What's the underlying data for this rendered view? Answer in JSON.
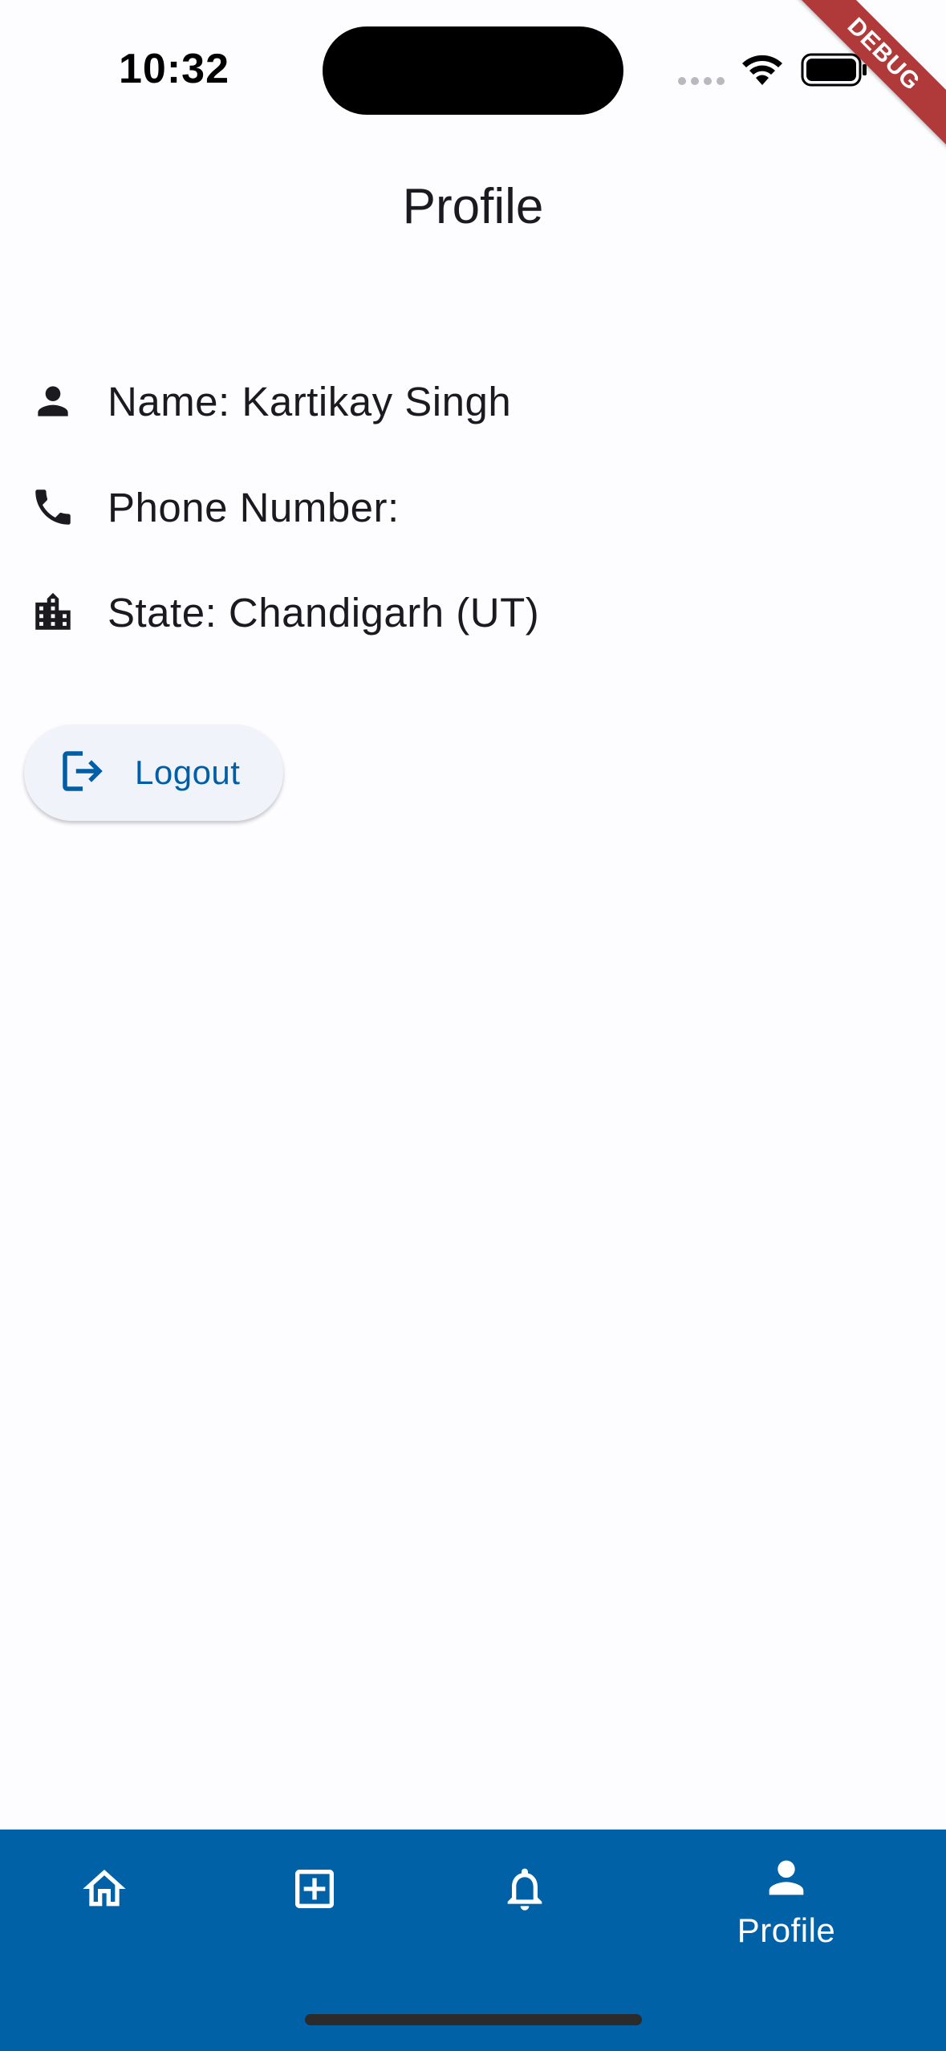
{
  "status_bar": {
    "time": "10:32",
    "icons": [
      "cellular-signal-icon",
      "wifi-icon",
      "battery-icon"
    ]
  },
  "debug_banner": "DEBUG",
  "app_bar": {
    "title": "Profile"
  },
  "profile": {
    "rows": [
      {
        "icon": "person-icon",
        "label": "Name: Kartikay Singh"
      },
      {
        "icon": "phone-icon",
        "label": "Phone Number:"
      },
      {
        "icon": "building-icon",
        "label": "State: Chandigarh (UT)"
      }
    ],
    "logout": {
      "icon": "logout-icon",
      "label": "Logout"
    }
  },
  "bottom_nav": {
    "items": [
      {
        "icon": "home-icon",
        "label": ""
      },
      {
        "icon": "add-box-icon",
        "label": ""
      },
      {
        "icon": "bell-icon",
        "label": ""
      },
      {
        "icon": "person-icon",
        "label": "Profile",
        "selected": true
      }
    ]
  },
  "colors": {
    "primary": "#0061a6",
    "background": "#fdfcff",
    "button_surface": "#f0f3f9",
    "debug_ribbon": "#b03a3a"
  }
}
